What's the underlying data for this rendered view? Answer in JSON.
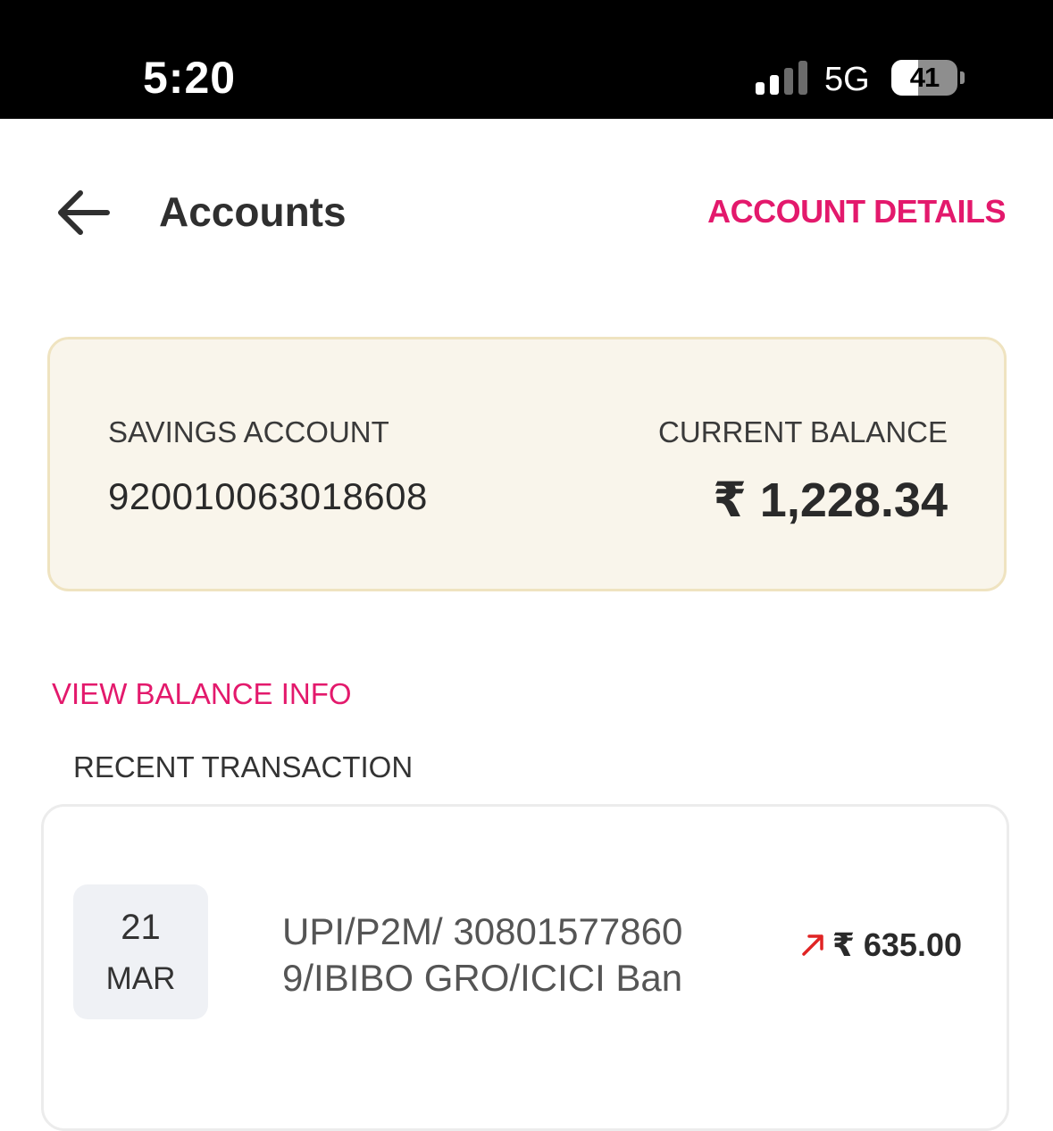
{
  "status_bar": {
    "time": "5:20",
    "network": "5G",
    "battery_level": 41,
    "battery_text": "41",
    "signal_bars_active": 2,
    "signal_bars_total": 4
  },
  "header": {
    "title": "Accounts",
    "back_icon": "arrow-left-icon",
    "account_details_label": "ACCOUNT DETAILS"
  },
  "account_card": {
    "type_label": "SAVINGS ACCOUNT",
    "account_number": "920010063018608",
    "balance_label": "CURRENT BALANCE",
    "balance_value": "₹ 1,228.34"
  },
  "links": {
    "view_balance_info": "VIEW BALANCE INFO"
  },
  "recent_transactions": {
    "title": "RECENT TRANSACTION",
    "items": [
      {
        "day": "21",
        "month": "MAR",
        "description": "UPI/P2M/ 308015778609/IBIBO GRO/ICICI Ban",
        "amount": "₹ 635.00",
        "direction_icon": "arrow-up-right-icon"
      }
    ]
  },
  "colors": {
    "accent": "#e3196c",
    "card_bg": "#f9f5eb",
    "card_border": "#efe3c0",
    "debit_arrow": "#e02424"
  }
}
